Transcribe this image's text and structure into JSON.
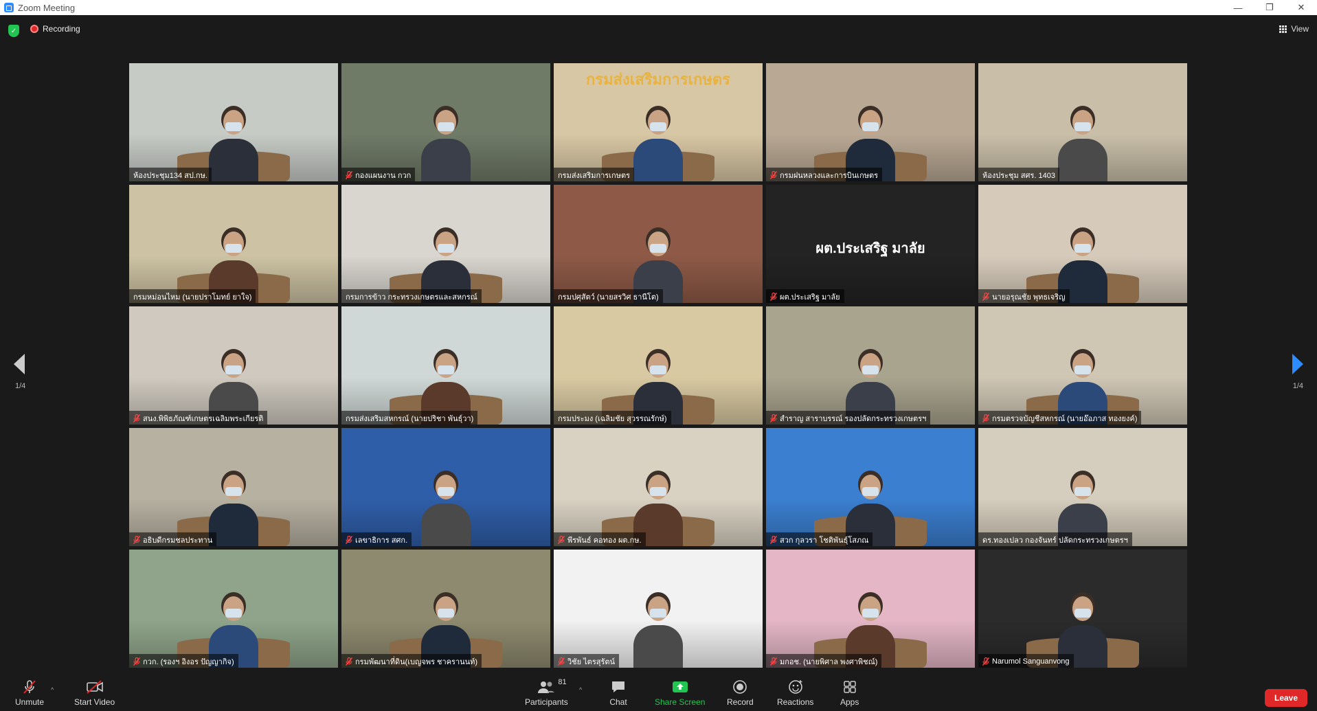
{
  "window": {
    "title": "Zoom Meeting",
    "minimize": "—",
    "restore": "❐",
    "close": "✕"
  },
  "topbar": {
    "recording_label": "Recording",
    "view_label": "View"
  },
  "pager": {
    "left": "1/4",
    "right": "1/4"
  },
  "tiles": [
    {
      "name": "ห้องประชุม134 สป.กษ.",
      "muted": false,
      "active": false,
      "bg": "#c7cbc6"
    },
    {
      "name": "กองแผนงาน กวก",
      "muted": true,
      "active": false,
      "bg": "#6f7a67"
    },
    {
      "name": "กรมส่งเสริมการเกษตร",
      "muted": false,
      "active": false,
      "bg": "#d8c7a4",
      "banner": "กรมส่งเสริมการเกษตร"
    },
    {
      "name": "กรมฝนหลวงและการบินเกษตร",
      "muted": true,
      "active": false,
      "bg": "#b9a894"
    },
    {
      "name": "ห้องประชุม สศร. 1403",
      "muted": false,
      "active": false,
      "bg": "#c9bfa9"
    },
    {
      "name": "กรมหม่อนไหม (นายปราโมทย์ ยาใจ)",
      "muted": false,
      "active": false,
      "bg": "#cdc3a4"
    },
    {
      "name": "กรมการข้าว กระทรวงเกษตรและสหกรณ์",
      "muted": false,
      "active": false,
      "bg": "#d9d6cf"
    },
    {
      "name": "กรมปศุสัตว์ (นายสรวิศ ธานีโต)",
      "muted": false,
      "active": true,
      "bg": "#8e5a47"
    },
    {
      "name": "ผต.ประเสริฐ มาลัย",
      "muted": true,
      "active": false,
      "bg": "#232323",
      "big": "ผต.ประเสริฐ มาลัย"
    },
    {
      "name": "นายอรุณชัย พุทธเจริญ",
      "muted": true,
      "active": false,
      "bg": "#d6cbbb"
    },
    {
      "name": "สนง.พิพิธภัณฑ์เกษตรเฉลิมพระเกียรติ",
      "muted": true,
      "active": false,
      "bg": "#cfc9bf"
    },
    {
      "name": "กรมส่งเสริมสหกรณ์ (นายปริชา พันธุ์วา)",
      "muted": false,
      "active": false,
      "bg": "#cfd8d6"
    },
    {
      "name": "กรมประมง (เฉลิมชัย สุวรรณรักษ์)",
      "muted": false,
      "active": false,
      "bg": "#d8c9a2"
    },
    {
      "name": "สำราญ สาราบรรณ์ รองปลัดกระทรวงเกษตรฯ",
      "muted": true,
      "active": false,
      "bg": "#a9a48e"
    },
    {
      "name": "กรมตรวจบัญชีสหกรณ์ (นายอ๊อภาส ทองยงค์)",
      "muted": true,
      "active": false,
      "bg": "#cfc6b4"
    },
    {
      "name": "อธิบดีกรมชลประทาน",
      "muted": true,
      "active": false,
      "bg": "#b7b1a2"
    },
    {
      "name": "เลขาธิการ สศก.",
      "muted": true,
      "active": false,
      "bg": "#2f5ea8"
    },
    {
      "name": "พีรพันธ์ คอทอง ผต.กษ.",
      "muted": true,
      "active": false,
      "bg": "#d9d2c3"
    },
    {
      "name": "สวก กุลวรา โชติพันธุ์โสภณ",
      "muted": true,
      "active": false,
      "bg": "#3b7fd0"
    },
    {
      "name": "ดร.ทองเปลว กองจันทร์ ปลัดกระทรวงเกษตรฯ",
      "muted": false,
      "active": false,
      "bg": "#d5cdbd"
    },
    {
      "name": "กวก. (รองฯ อิงอร ปัญญากิจ)",
      "muted": true,
      "active": false,
      "bg": "#8fa48a"
    },
    {
      "name": "กรมพัฒนาที่ดิน(เบญจพร ชาครานนท์)",
      "muted": true,
      "active": false,
      "bg": "#8e8a6f"
    },
    {
      "name": "วิชัย ไตรสุรัตน์",
      "muted": true,
      "active": false,
      "bg": "#f2f2f2"
    },
    {
      "name": "มกอช. (นายพิศาล พงศาพิชณ์)",
      "muted": true,
      "active": false,
      "bg": "#e4b6c6"
    },
    {
      "name": "Narumol Sanguanvong",
      "muted": true,
      "active": false,
      "bg": "#2b2b2b"
    }
  ],
  "toolbar": {
    "unmute": "Unmute",
    "start_video": "Start Video",
    "participants": "Participants",
    "participants_count": "81",
    "chat": "Chat",
    "share_screen": "Share Screen",
    "record": "Record",
    "reactions": "Reactions",
    "apps": "Apps",
    "leave": "Leave"
  },
  "colors": {
    "accent_blue": "#2d8cff",
    "share_green": "#23c552",
    "leave_red": "#e02828",
    "active_speaker": "#e6e600"
  }
}
